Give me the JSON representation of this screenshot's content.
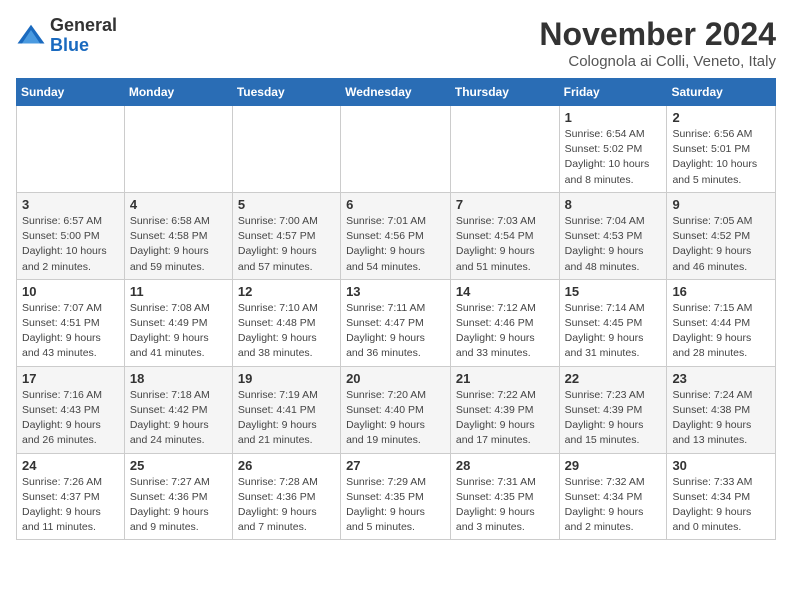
{
  "header": {
    "logo_general": "General",
    "logo_blue": "Blue",
    "month_title": "November 2024",
    "location": "Colognola ai Colli, Veneto, Italy"
  },
  "weekdays": [
    "Sunday",
    "Monday",
    "Tuesday",
    "Wednesday",
    "Thursday",
    "Friday",
    "Saturday"
  ],
  "weeks": [
    [
      {
        "day": "",
        "info": ""
      },
      {
        "day": "",
        "info": ""
      },
      {
        "day": "",
        "info": ""
      },
      {
        "day": "",
        "info": ""
      },
      {
        "day": "",
        "info": ""
      },
      {
        "day": "1",
        "info": "Sunrise: 6:54 AM\nSunset: 5:02 PM\nDaylight: 10 hours and 8 minutes."
      },
      {
        "day": "2",
        "info": "Sunrise: 6:56 AM\nSunset: 5:01 PM\nDaylight: 10 hours and 5 minutes."
      }
    ],
    [
      {
        "day": "3",
        "info": "Sunrise: 6:57 AM\nSunset: 5:00 PM\nDaylight: 10 hours and 2 minutes."
      },
      {
        "day": "4",
        "info": "Sunrise: 6:58 AM\nSunset: 4:58 PM\nDaylight: 9 hours and 59 minutes."
      },
      {
        "day": "5",
        "info": "Sunrise: 7:00 AM\nSunset: 4:57 PM\nDaylight: 9 hours and 57 minutes."
      },
      {
        "day": "6",
        "info": "Sunrise: 7:01 AM\nSunset: 4:56 PM\nDaylight: 9 hours and 54 minutes."
      },
      {
        "day": "7",
        "info": "Sunrise: 7:03 AM\nSunset: 4:54 PM\nDaylight: 9 hours and 51 minutes."
      },
      {
        "day": "8",
        "info": "Sunrise: 7:04 AM\nSunset: 4:53 PM\nDaylight: 9 hours and 48 minutes."
      },
      {
        "day": "9",
        "info": "Sunrise: 7:05 AM\nSunset: 4:52 PM\nDaylight: 9 hours and 46 minutes."
      }
    ],
    [
      {
        "day": "10",
        "info": "Sunrise: 7:07 AM\nSunset: 4:51 PM\nDaylight: 9 hours and 43 minutes."
      },
      {
        "day": "11",
        "info": "Sunrise: 7:08 AM\nSunset: 4:49 PM\nDaylight: 9 hours and 41 minutes."
      },
      {
        "day": "12",
        "info": "Sunrise: 7:10 AM\nSunset: 4:48 PM\nDaylight: 9 hours and 38 minutes."
      },
      {
        "day": "13",
        "info": "Sunrise: 7:11 AM\nSunset: 4:47 PM\nDaylight: 9 hours and 36 minutes."
      },
      {
        "day": "14",
        "info": "Sunrise: 7:12 AM\nSunset: 4:46 PM\nDaylight: 9 hours and 33 minutes."
      },
      {
        "day": "15",
        "info": "Sunrise: 7:14 AM\nSunset: 4:45 PM\nDaylight: 9 hours and 31 minutes."
      },
      {
        "day": "16",
        "info": "Sunrise: 7:15 AM\nSunset: 4:44 PM\nDaylight: 9 hours and 28 minutes."
      }
    ],
    [
      {
        "day": "17",
        "info": "Sunrise: 7:16 AM\nSunset: 4:43 PM\nDaylight: 9 hours and 26 minutes."
      },
      {
        "day": "18",
        "info": "Sunrise: 7:18 AM\nSunset: 4:42 PM\nDaylight: 9 hours and 24 minutes."
      },
      {
        "day": "19",
        "info": "Sunrise: 7:19 AM\nSunset: 4:41 PM\nDaylight: 9 hours and 21 minutes."
      },
      {
        "day": "20",
        "info": "Sunrise: 7:20 AM\nSunset: 4:40 PM\nDaylight: 9 hours and 19 minutes."
      },
      {
        "day": "21",
        "info": "Sunrise: 7:22 AM\nSunset: 4:39 PM\nDaylight: 9 hours and 17 minutes."
      },
      {
        "day": "22",
        "info": "Sunrise: 7:23 AM\nSunset: 4:39 PM\nDaylight: 9 hours and 15 minutes."
      },
      {
        "day": "23",
        "info": "Sunrise: 7:24 AM\nSunset: 4:38 PM\nDaylight: 9 hours and 13 minutes."
      }
    ],
    [
      {
        "day": "24",
        "info": "Sunrise: 7:26 AM\nSunset: 4:37 PM\nDaylight: 9 hours and 11 minutes."
      },
      {
        "day": "25",
        "info": "Sunrise: 7:27 AM\nSunset: 4:36 PM\nDaylight: 9 hours and 9 minutes."
      },
      {
        "day": "26",
        "info": "Sunrise: 7:28 AM\nSunset: 4:36 PM\nDaylight: 9 hours and 7 minutes."
      },
      {
        "day": "27",
        "info": "Sunrise: 7:29 AM\nSunset: 4:35 PM\nDaylight: 9 hours and 5 minutes."
      },
      {
        "day": "28",
        "info": "Sunrise: 7:31 AM\nSunset: 4:35 PM\nDaylight: 9 hours and 3 minutes."
      },
      {
        "day": "29",
        "info": "Sunrise: 7:32 AM\nSunset: 4:34 PM\nDaylight: 9 hours and 2 minutes."
      },
      {
        "day": "30",
        "info": "Sunrise: 7:33 AM\nSunset: 4:34 PM\nDaylight: 9 hours and 0 minutes."
      }
    ]
  ]
}
